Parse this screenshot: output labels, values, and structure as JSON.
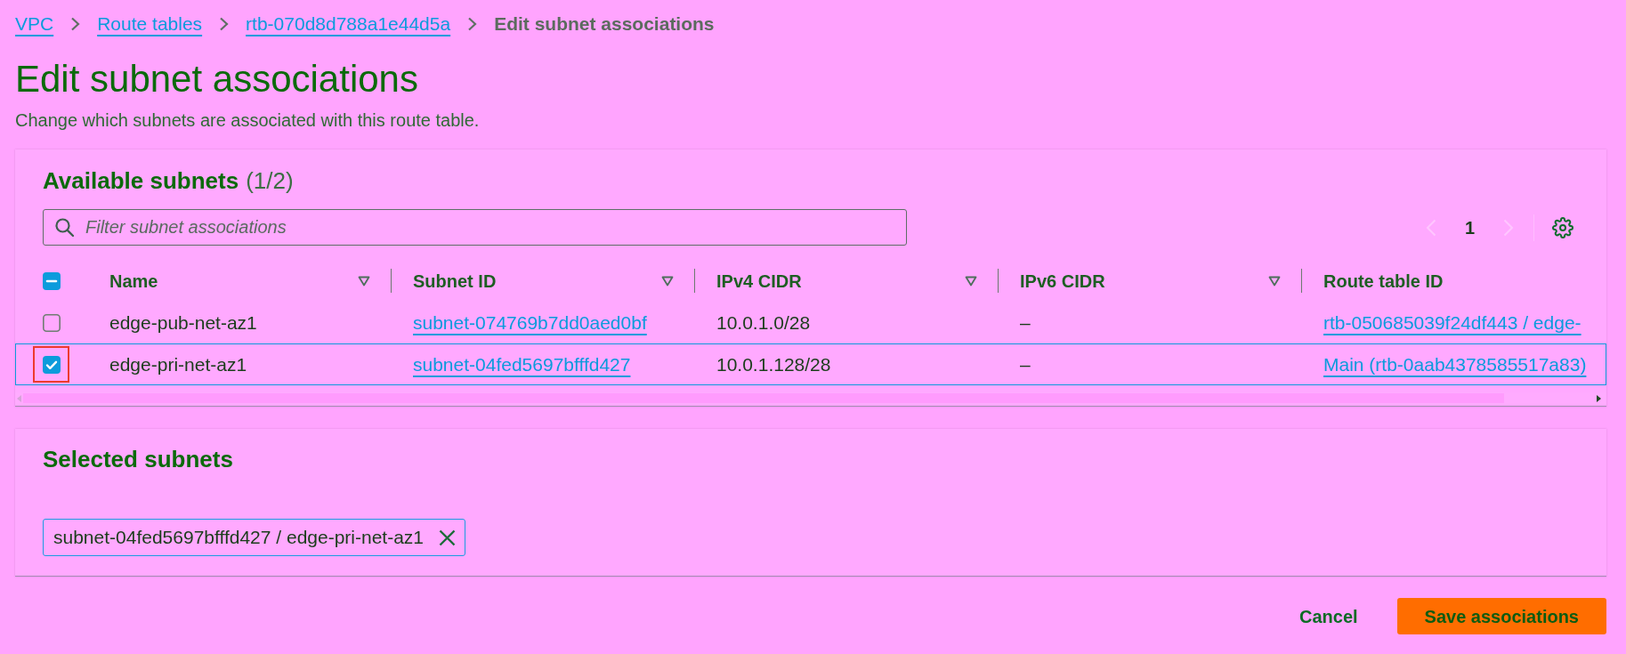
{
  "breadcrumbs": [
    {
      "label": "VPC",
      "kind": "link"
    },
    {
      "label": "Route tables",
      "kind": "link"
    },
    {
      "label": "rtb-070d8d788a1e44d5a",
      "kind": "link"
    },
    {
      "label": "Edit subnet associations",
      "kind": "current"
    }
  ],
  "header": {
    "title": "Edit subnet associations",
    "description": "Change which subnets are associated with this route table."
  },
  "available_subnets": {
    "title": "Available subnets",
    "count": "(1/2)",
    "filter": {
      "placeholder": "Filter subnet associations"
    },
    "pagination": {
      "previous_disabled": true,
      "page": "1",
      "next_disabled": true
    },
    "select_all": {
      "indeterminate": true
    },
    "columns": [
      {
        "label": "Name",
        "sortable": true
      },
      {
        "label": "Subnet ID",
        "sortable": true
      },
      {
        "label": "IPv4 CIDR",
        "sortable": true
      },
      {
        "label": "IPv6 CIDR",
        "sortable": true
      },
      {
        "label": "Route table ID",
        "sortable": false
      }
    ],
    "rows": [
      {
        "checked": false,
        "selected": false,
        "highlighted": false,
        "cells": [
          {
            "kind": "text",
            "text": "edge-pub-net-az1"
          },
          {
            "kind": "link",
            "text": "subnet-074769b7dd0aed0bf"
          },
          {
            "kind": "text",
            "text": "10.0.1.0/28"
          },
          {
            "kind": "text",
            "text": "–"
          },
          {
            "kind": "link",
            "text": "rtb-050685039f24df443 / edge-"
          }
        ]
      },
      {
        "checked": true,
        "selected": true,
        "highlighted": true,
        "cells": [
          {
            "kind": "text",
            "text": "edge-pri-net-az1"
          },
          {
            "kind": "link",
            "text": "subnet-04fed5697bfffd427"
          },
          {
            "kind": "text",
            "text": "10.0.1.128/28"
          },
          {
            "kind": "text",
            "text": "–"
          },
          {
            "kind": "link",
            "text": "Main (rtb-0aab4378585517a83)"
          }
        ]
      }
    ]
  },
  "selected_subnets": {
    "title": "Selected subnets",
    "tokens": [
      {
        "label": "subnet-04fed5697bfffd427 / edge-pri-net-az1"
      }
    ]
  },
  "actions": [
    {
      "label": "Cancel",
      "kind": "link"
    },
    {
      "label": "Save associations",
      "kind": "primary"
    }
  ]
}
